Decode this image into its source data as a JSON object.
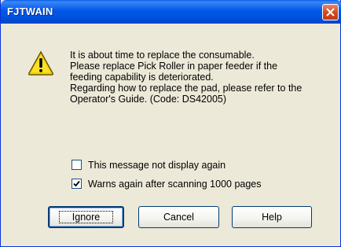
{
  "window": {
    "title": "FJTWAIN",
    "close_icon": "close-icon",
    "warning_icon": "warning-icon"
  },
  "message": {
    "lines": [
      "It is about time to replace the consumable.",
      "Please replace Pick Roller in paper feeder if the",
      "feeding capability is deteriorated.",
      "Regarding how to replace the pad, please refer to the",
      "Operator's Guide. (Code: DS42005)"
    ]
  },
  "checkboxes": [
    {
      "label": "This message not display again",
      "checked": false
    },
    {
      "label": "Warns again after scanning 1000 pages",
      "checked": true
    }
  ],
  "buttons": {
    "ignore": "Ignore",
    "cancel": "Cancel",
    "help": "Help"
  },
  "colors": {
    "titlebar": "#0058e6",
    "dialog_background": "#ece9d8",
    "close_button": "#d44a22",
    "warning_yellow": "#f5d400"
  }
}
